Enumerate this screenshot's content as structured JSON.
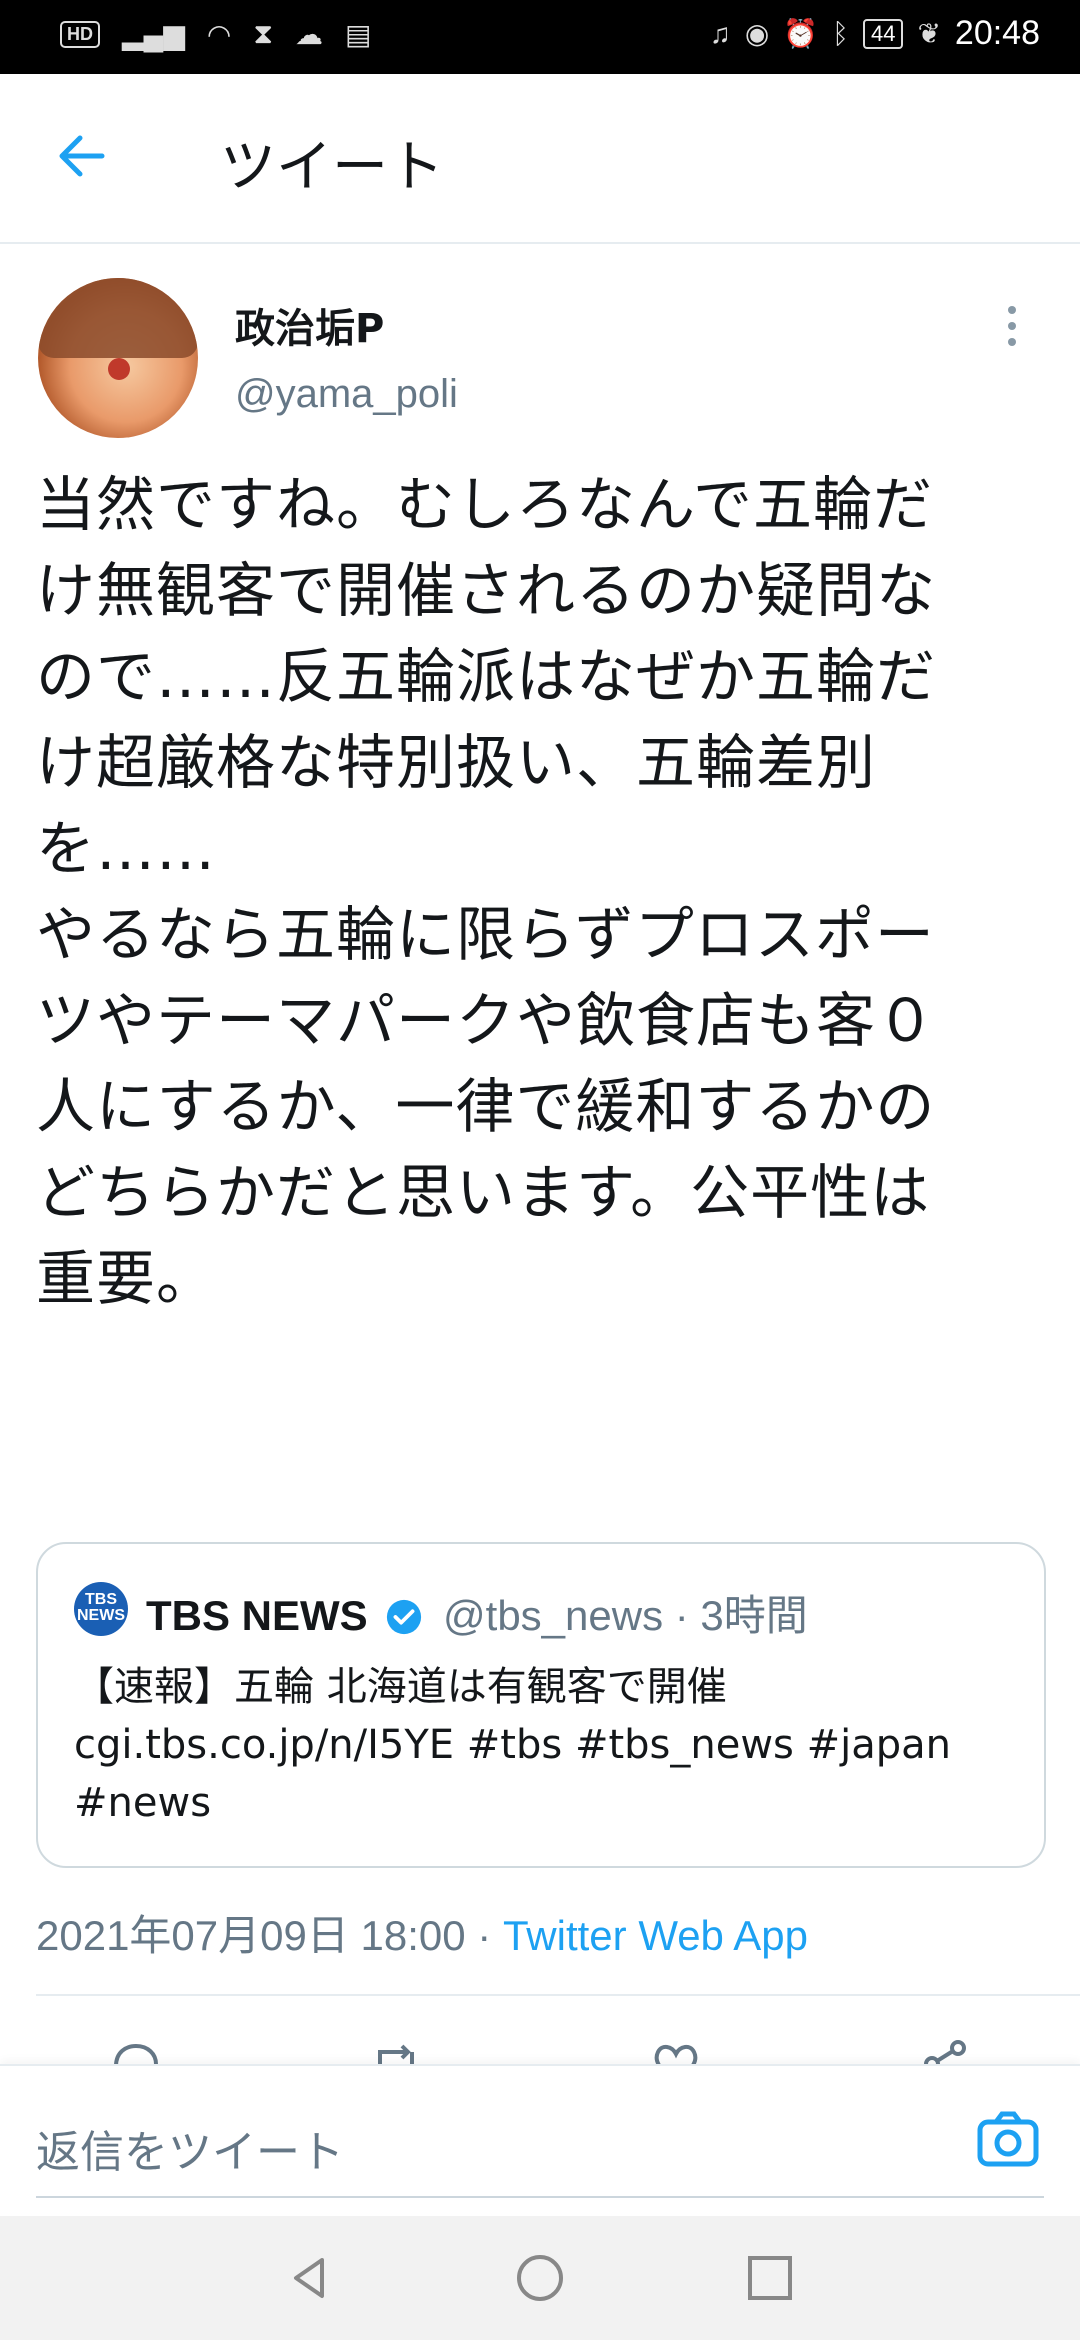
{
  "status_bar": {
    "left_icons": [
      "hd-icon",
      "signal-icon",
      "wifi-icon",
      "hourglass-icon",
      "cloud-icon",
      "sim-icon"
    ],
    "hd": "HD",
    "right_icons": [
      "headphones-icon",
      "eye-icon",
      "alarm-icon",
      "bluetooth-icon",
      "battery-icon",
      "leaf-icon"
    ],
    "battery": "44",
    "time": "20:48"
  },
  "header": {
    "title": "ツイート"
  },
  "tweet": {
    "name": "政治垢P",
    "handle": "@yama_poli",
    "text": "当然ですね。むしろなんで五輪だ\nけ無観客で開催されるのか疑問な\nので……反五輪派はなぜか五輪だ\nけ超厳格な特別扱い、五輪差別\nを……\nやるなら五輪に限らずプロスポー\nツやテーマパークや飲食店も客０\n人にするか、一律で緩和するかの\nどちらかだと思います。公平性は\n重要。",
    "quoted": {
      "logo": "TBS NEWS",
      "name": "TBS NEWS",
      "meta": "@tbs_news · 3時間",
      "text": "【速報】五輪 北海道は有観客で開催\ncgi.tbs.co.jp/n/I5YE #tbs #tbs_news #japan\n#news"
    },
    "timestamp": "2021年07月09日 18:00 · ",
    "source": "Twitter Web App"
  },
  "reply_bar": {
    "placeholder": "返信をツイート"
  },
  "colors": {
    "accent": "#1da1f2",
    "muted": "#657786"
  }
}
